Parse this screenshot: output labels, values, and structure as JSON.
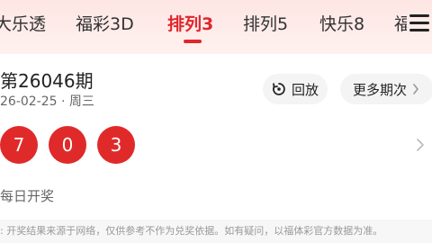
{
  "tabs": [
    {
      "label": "大乐透",
      "active": false
    },
    {
      "label": "福彩3D",
      "active": false
    },
    {
      "label": "排列3",
      "active": true
    },
    {
      "label": "排列5",
      "active": false
    },
    {
      "label": "快乐8",
      "active": false
    },
    {
      "label": "福",
      "active": false
    }
  ],
  "draw": {
    "issue": "第26046期",
    "date": "26-02-25 · 周三",
    "numbers": [
      "7",
      "0",
      "3"
    ]
  },
  "actions": {
    "replay_label": "回放",
    "more_label": "更多期次"
  },
  "section_label": "每日开奖",
  "disclaimer": ": 开奖结果来源于网络，仅供参考不作为兑奖依据。如有疑问，以福体彩官方数据为准。",
  "colors": {
    "accent": "#e0262b",
    "ball": "#e02a2a"
  },
  "icons": {
    "menu": "menu-icon",
    "replay": "replay-icon",
    "more": "chevron-right-icon"
  }
}
